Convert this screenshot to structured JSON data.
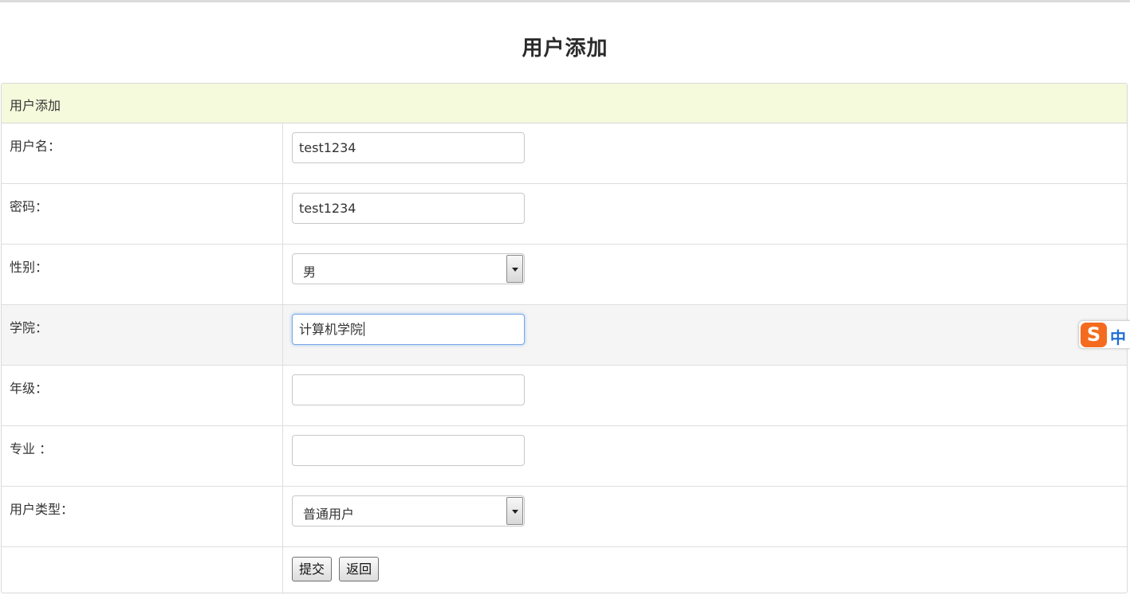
{
  "page": {
    "title": "用户添加"
  },
  "panel": {
    "header": "用户添加"
  },
  "form": {
    "username": {
      "label": "用户名：",
      "value": "test1234"
    },
    "password": {
      "label": "密码：",
      "value": "test1234"
    },
    "gender": {
      "label": "性别：",
      "selected": "男"
    },
    "college": {
      "label": "学院：",
      "value": "计算机学院"
    },
    "grade": {
      "label": "年级：",
      "value": ""
    },
    "major": {
      "label": "专业 ：",
      "value": ""
    },
    "user_type": {
      "label": "用户类型：",
      "selected": "普通用户"
    },
    "submit_label": "提交",
    "back_label": "返回"
  },
  "ime": {
    "logo": "S",
    "mode": "中",
    "icon": "sogou-ime-icon",
    "color": "#f46b1f"
  },
  "colors": {
    "header_bg": "#f4fadb",
    "focus_border": "#76a9e8",
    "highlight_row": "#f5f5f5"
  }
}
